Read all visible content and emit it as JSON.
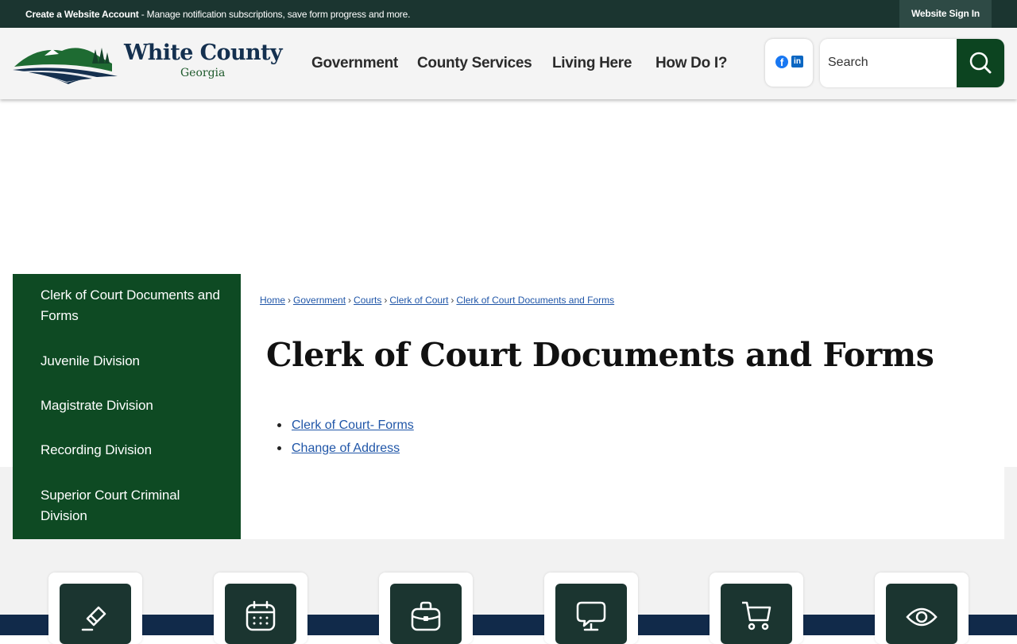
{
  "topbar": {
    "create_account": "Create a Website Account",
    "message": " - Manage notification subscriptions, save form progress and more.",
    "sign_in": "Website Sign In"
  },
  "logo": {
    "name": "White County",
    "state": "Georgia"
  },
  "nav": [
    "Government",
    "County Services",
    "Living Here",
    "How Do I?"
  ],
  "social": {
    "facebook": "f",
    "linkedin": "in"
  },
  "search": {
    "placeholder": "Search"
  },
  "sidebar": {
    "items": [
      "Clerk of Court Documents and Forms",
      "Juvenile Division",
      "Magistrate Division",
      "Recording Division",
      "Superior Court Criminal Division"
    ]
  },
  "breadcrumb": [
    "Home",
    "Government",
    "Courts",
    "Clerk of Court",
    "Clerk of Court Documents and Forms"
  ],
  "breadcrumb_sep": "›",
  "page_title": "Clerk of Court Documents and Forms",
  "links": [
    "Clerk of Court- Forms",
    "Change of Address"
  ],
  "quick_links": [
    "eraser-icon",
    "calendar-icon",
    "briefcase-icon",
    "chat-monitor-icon",
    "cart-icon",
    "eye-icon"
  ],
  "colors": {
    "topbar": "#1b3530",
    "sidebar": "#0e4a23",
    "search_button": "#0c4420",
    "link": "#2056a8",
    "footer_strip": "#112a4a"
  }
}
